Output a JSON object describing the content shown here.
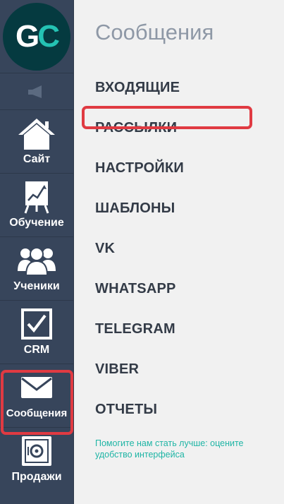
{
  "logo": {
    "g": "G",
    "c": "C"
  },
  "sidebar": {
    "items": [
      {
        "label": "Сайт",
        "icon": "home-icon"
      },
      {
        "label": "Обучение",
        "icon": "presentation-chart-icon"
      },
      {
        "label": "Ученики",
        "icon": "users-icon"
      },
      {
        "label": "CRM",
        "icon": "checkbox-icon"
      },
      {
        "label": "Сообщения",
        "icon": "envelope-icon"
      },
      {
        "label": "Продажи",
        "icon": "safe-icon"
      }
    ]
  },
  "main": {
    "title": "Сообщения",
    "menu": [
      "ВХОДЯЩИЕ",
      "РАССЫЛКИ",
      "НАСТРОЙКИ",
      "ШАБЛОНЫ",
      "VK",
      "WHATSAPP",
      "TELEGRAM",
      "VIBER",
      "ОТЧЕТЫ"
    ],
    "feedback": "Помогите нам стать лучше: оцените удобство интерфейса"
  },
  "colors": {
    "sidebar_bg": "#37455b",
    "logo_bg": "#053a40",
    "accent_teal": "#24c2b3",
    "highlight_red": "#e03a42"
  }
}
